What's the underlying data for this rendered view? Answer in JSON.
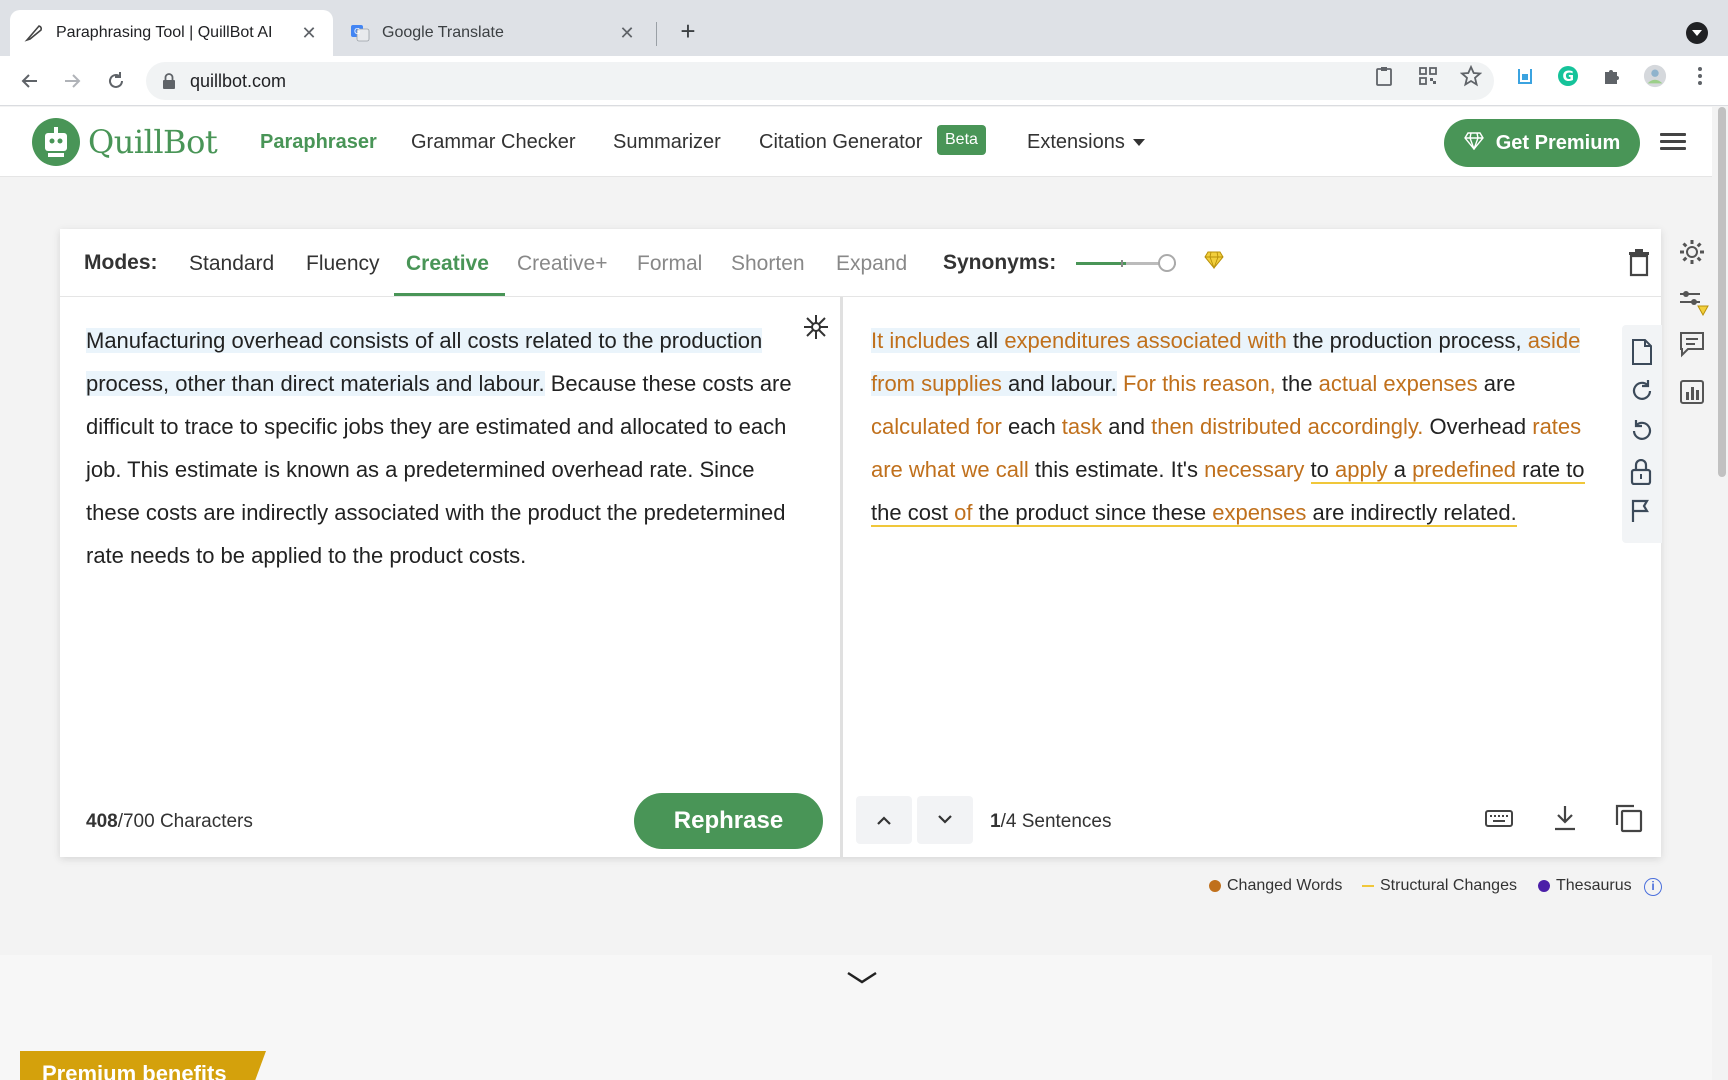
{
  "browser": {
    "tabs": [
      {
        "title": "Paraphrasing Tool | QuillBot AI",
        "close": "✕"
      },
      {
        "title": "Google Translate",
        "close": "✕"
      }
    ],
    "new_tab": "+",
    "url": "quillbot.com"
  },
  "header": {
    "logo_text": "QuillBot",
    "nav": {
      "paraphraser": "Paraphraser",
      "grammar_checker": "Grammar Checker",
      "summarizer": "Summarizer",
      "citation_generator": "Citation Generator",
      "beta_badge": "Beta",
      "extensions": "Extensions"
    },
    "premium_button": "Get Premium"
  },
  "editor": {
    "modes_label": "Modes:",
    "modes": [
      "Standard",
      "Fluency",
      "Creative",
      "Creative+",
      "Formal",
      "Shorten",
      "Expand"
    ],
    "active_mode": "Creative",
    "synonyms_label": "Synonyms:",
    "synonyms_level": 0.5,
    "input": {
      "highlighted_sentence": "Manufacturing overhead consists of all costs related to the production process, other than direct materials and labour.",
      "rest_text": " Because these costs are difficult to trace to specific jobs they are estimated and allocated to each job. This estimate is known as a predetermined overhead rate. Since these costs are indirectly associated with the product the predetermined rate needs to be applied to the product costs."
    },
    "output": {
      "s1": [
        {
          "t": "It includes",
          "c": true
        },
        {
          "t": " all ",
          "c": false
        },
        {
          "t": "expenditures associated with",
          "c": true
        },
        {
          "t": " the production process,",
          "c": false
        },
        {
          "t": " ",
          "c": false
        },
        {
          "t": "aside from supplies",
          "c": true
        },
        {
          "t": " and labour.",
          "c": false
        }
      ],
      "s2": [
        {
          "t": " ",
          "c": false
        },
        {
          "t": "For this reason,",
          "c": true
        },
        {
          "t": " the ",
          "c": false
        },
        {
          "t": "actual expenses",
          "c": true
        },
        {
          "t": " are ",
          "c": false
        },
        {
          "t": "calculated for",
          "c": true
        },
        {
          "t": " each ",
          "c": false
        },
        {
          "t": "task",
          "c": true
        },
        {
          "t": " and ",
          "c": false
        },
        {
          "t": "then distributed accordingly.",
          "c": true
        },
        {
          "t": " Overhead ",
          "c": false
        },
        {
          "t": "rates are what we call",
          "c": true
        },
        {
          "t": " this estimate. It's ",
          "c": false
        },
        {
          "t": "necessary",
          "c": true
        },
        {
          "t": " ",
          "c": false
        }
      ],
      "s3": [
        {
          "t": "to ",
          "c": false
        },
        {
          "t": "apply",
          "c": true
        },
        {
          "t": " a ",
          "c": false
        },
        {
          "t": "predefined",
          "c": true
        },
        {
          "t": " rate to the cost ",
          "c": false
        },
        {
          "t": "of",
          "c": true
        },
        {
          "t": " the product since these ",
          "c": false
        },
        {
          "t": "expenses",
          "c": true
        },
        {
          "t": " are indirectly related.",
          "c": false
        }
      ]
    },
    "char_count_current": "408",
    "char_count_rest": "/700 Characters",
    "rephrase_button": "Rephrase",
    "sentence_current": "1",
    "sentence_rest": "/4 Sentences"
  },
  "legend": {
    "changed_words": "Changed Words",
    "structural_changes": "Structural Changes",
    "thesaurus": "Thesaurus",
    "info": "i"
  },
  "bottom": {
    "premium_benefits": "Premium benefits"
  },
  "colors": {
    "brand_green": "#499557",
    "changed_words": "#c0701c",
    "structural": "#f0c73a",
    "thesaurus": "#4b1fa8",
    "premium_gold": "#d4a10c"
  },
  "icons": {
    "tab_1_favicon": "quill-icon",
    "tab_2_favicon": "google-translate-icon",
    "gem": "diamond-icon",
    "freeze": "snowflake-icon"
  }
}
